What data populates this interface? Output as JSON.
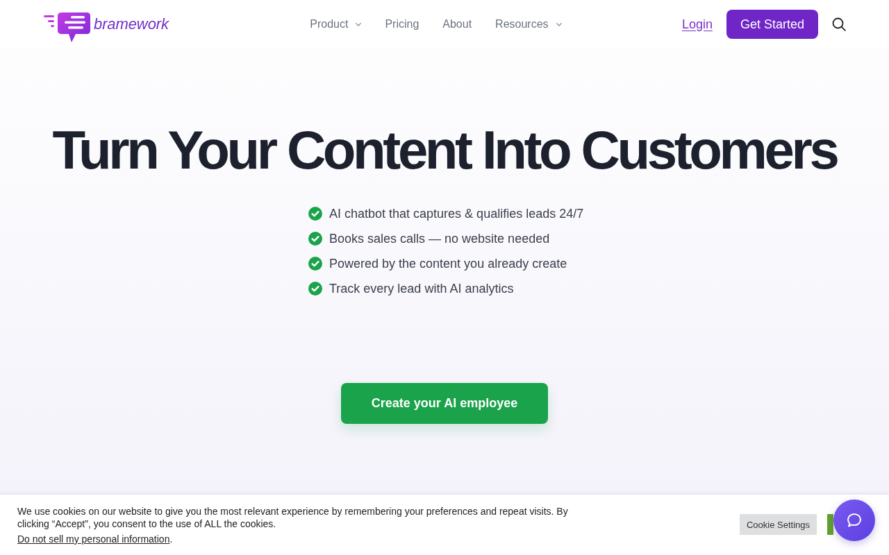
{
  "header": {
    "logo": {
      "text": "bramework"
    },
    "nav": [
      {
        "label": "Product",
        "dropdown": true
      },
      {
        "label": "Pricing",
        "dropdown": false
      },
      {
        "label": "About",
        "dropdown": false
      },
      {
        "label": "Resources",
        "dropdown": true
      }
    ],
    "login": "Login",
    "cta": "Get Started"
  },
  "hero": {
    "title": "Turn Your Content Into Customers",
    "features": [
      "AI chatbot that captures & qualifies leads 24/7",
      "Books sales calls — no website needed",
      "Powered by the content you already create",
      "Track every lead with AI analytics"
    ],
    "cta": "Create your AI employee"
  },
  "cookie_banner": {
    "message": "We use cookies on our website to give you the most relevant experience by remembering your preferences and repeat visits. By clicking “Accept”, you consent to the use of ALL the cookies.",
    "optout": {
      "link": "Do not sell my personal information",
      "after": "."
    },
    "buttons": [
      {
        "kind": "settings",
        "label": "Cookie Settings"
      },
      {
        "kind": "accept"
      }
    ]
  }
}
